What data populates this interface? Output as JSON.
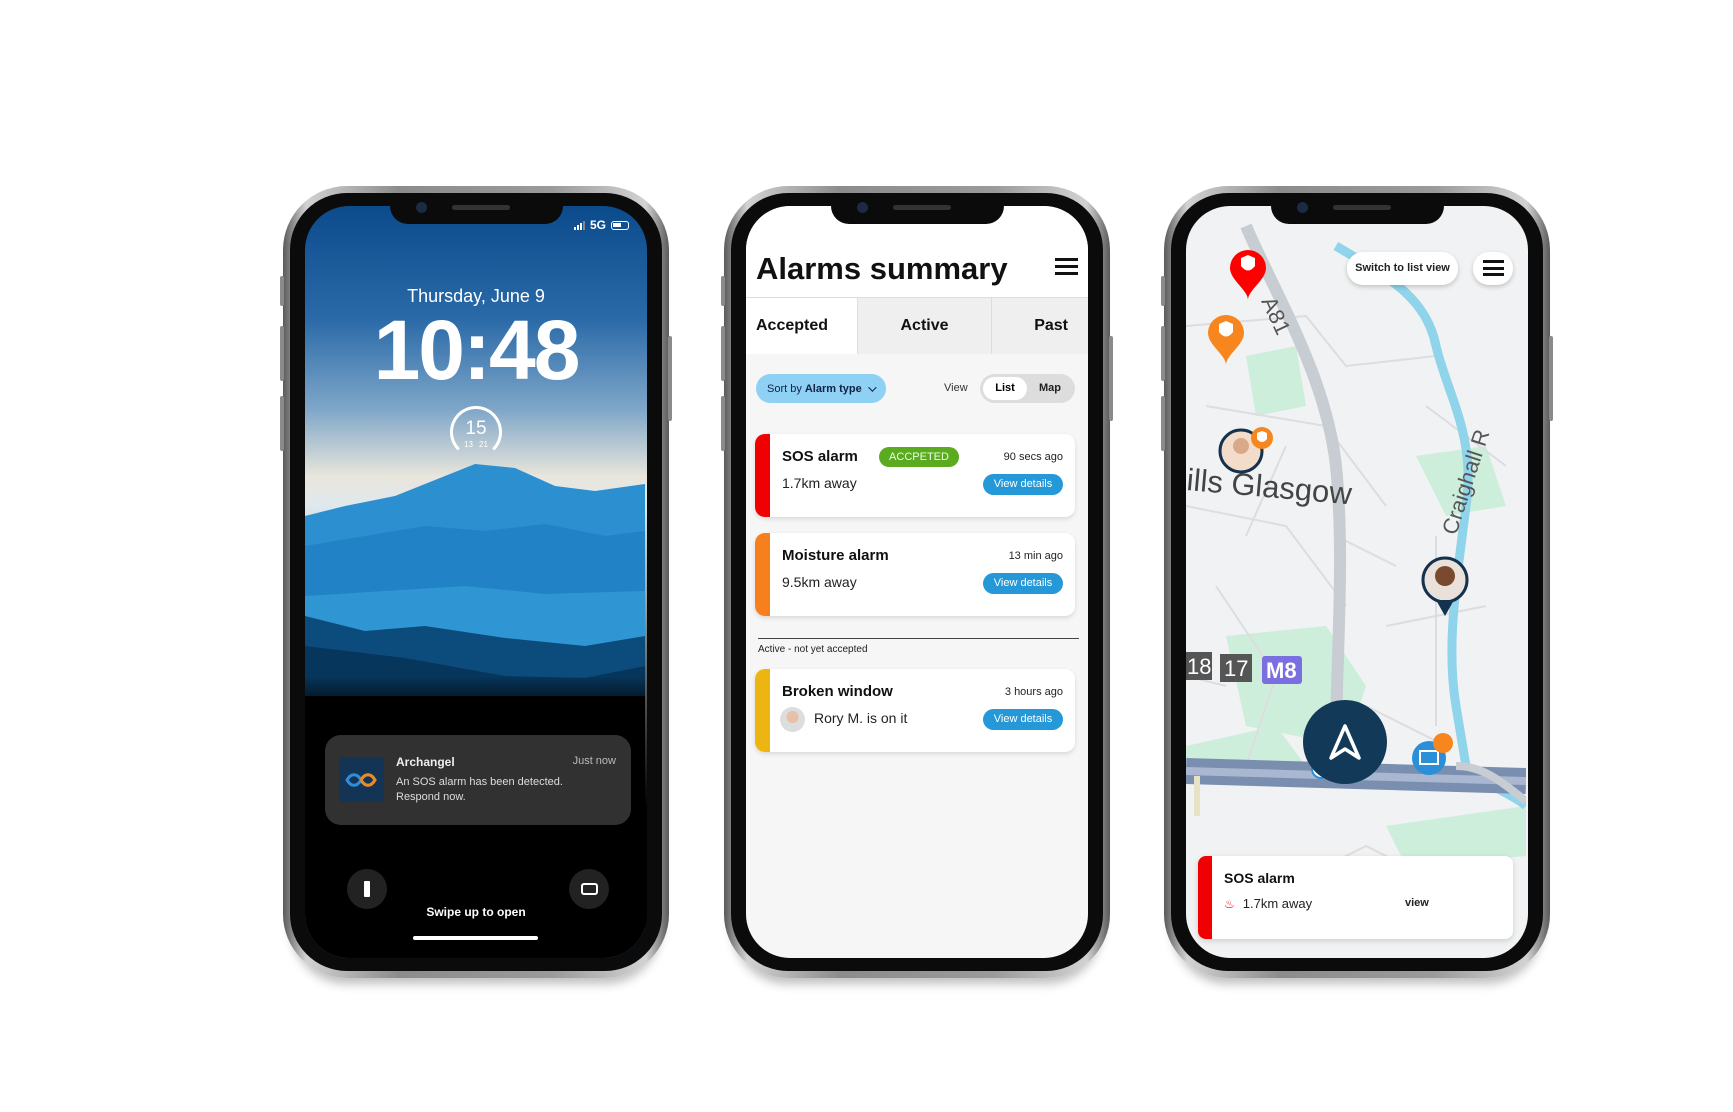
{
  "colors": {
    "accent": "#2598d8",
    "sos": "#f00000",
    "moisture": "#f77f1e",
    "broken_window": "#ecb512",
    "accepted": "#5aab1f",
    "nav_button": "#123a58",
    "sort_pill": "#8fd0f5"
  },
  "lock_screen": {
    "status": {
      "network": "5G",
      "signal_icon": "signal-bars-icon",
      "battery_icon": "battery-icon"
    },
    "date": "Thursday, June 9",
    "time": "10:48",
    "weather_widget": {
      "current": "15",
      "low": "13",
      "high": "21"
    },
    "notification": {
      "app": "Archangel",
      "time": "Just now",
      "message": "An SOS alarm has been detected. Respond now.",
      "icon": "archangel-logo"
    },
    "flashlight_icon": "flashlight-icon",
    "camera_icon": "camera-icon",
    "swipe_hint": "Swipe up to open"
  },
  "alarms_summary": {
    "title": "Alarms summary",
    "menu_icon": "hamburger-icon",
    "tabs": [
      {
        "label": "Accepted",
        "selected": true
      },
      {
        "label": "Active",
        "selected": false
      },
      {
        "label": "Past",
        "selected": false
      }
    ],
    "sort": {
      "prefix": "Sort by",
      "value": "Alarm type"
    },
    "view": {
      "label": "View",
      "options": [
        "List",
        "Map"
      ],
      "selected": "List"
    },
    "accepted_alarms": [
      {
        "title": "SOS alarm",
        "badge": "ACCPETED",
        "time": "90 secs ago",
        "distance": "1.7km away",
        "button": "View details",
        "color": "#f00000"
      },
      {
        "title": "Moisture alarm",
        "time": "13 min ago",
        "distance": "9.5km away",
        "button": "View details",
        "color": "#f77f1e"
      }
    ],
    "section_label": "Active - not yet accepted",
    "active_alarms": [
      {
        "title": "Broken window",
        "time": "3 hours ago",
        "responder": "Rory M. is on it",
        "button": "View details",
        "color": "#ecb512"
      }
    ]
  },
  "map_view": {
    "switch_button": "Switch to list view",
    "menu_icon": "hamburger-icon",
    "map_labels": {
      "road": "A81",
      "place": "ills Glasgow",
      "street": "Craighall R",
      "junction_a": "18",
      "junction_b": "17",
      "motorway": "M8"
    },
    "bottom_card": {
      "title": "SOS alarm",
      "distance": "1.7km away",
      "action": "view",
      "icon": "alarm-bell-icon"
    },
    "nav_icon": "navigation-arrow-icon"
  }
}
